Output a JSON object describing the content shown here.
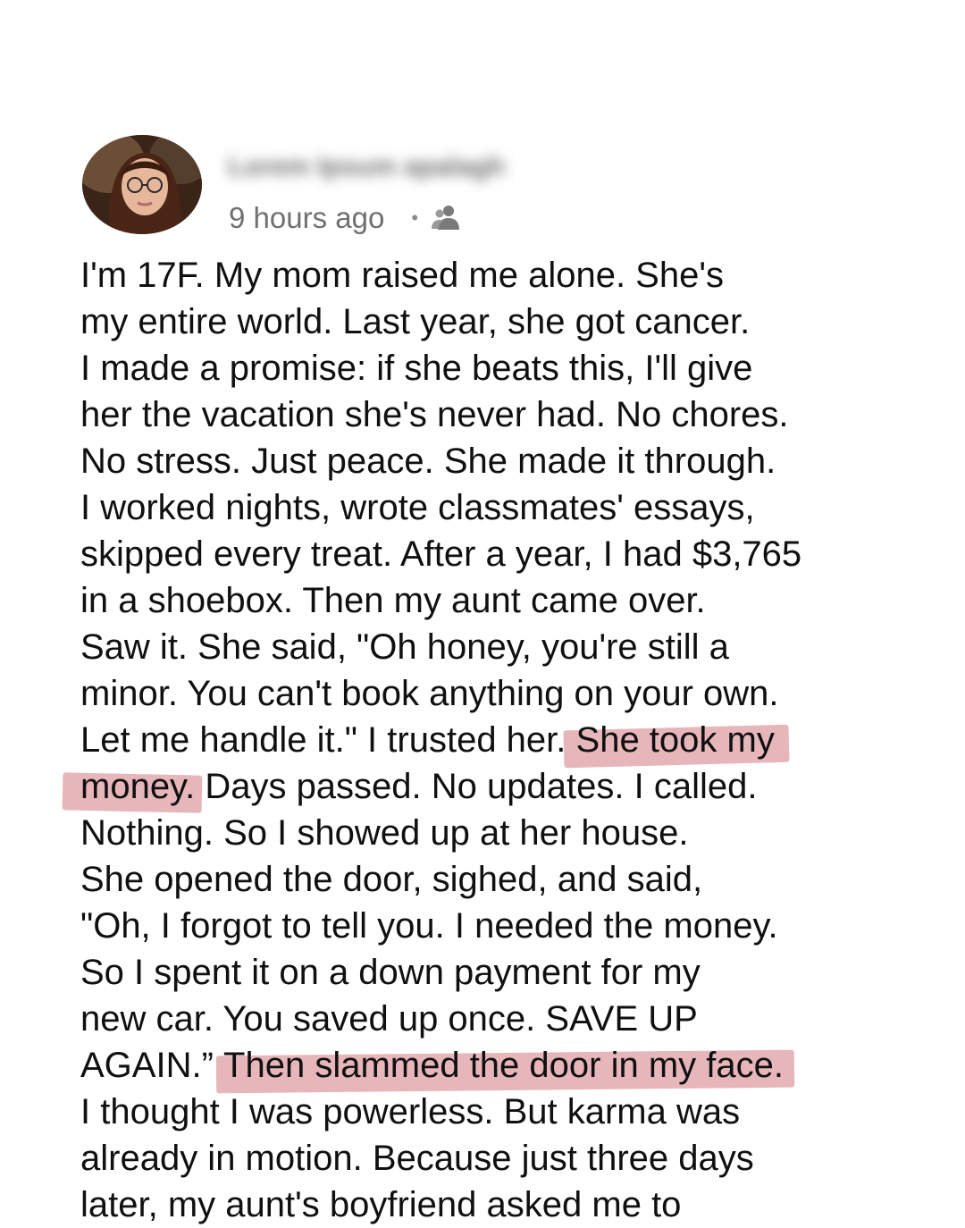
{
  "post": {
    "author_name": "Lorem Ipsum apalagh",
    "timestamp": "9 hours ago",
    "separator": "•",
    "audience_icon": "friends-icon",
    "highlight_color": "#e3a9ae",
    "lines": [
      [
        {
          "text": "I'm 17F. My mom raised me alone. She's"
        }
      ],
      [
        {
          "text": "my entire world. Last year, she got cancer."
        }
      ],
      [
        {
          "text": "I made a promise: if she beats this, I'll give"
        }
      ],
      [
        {
          "text": "her the vacation she's never had. No chores."
        }
      ],
      [
        {
          "text": "No stress. Just peace. She made it through."
        }
      ],
      [
        {
          "text": "I worked nights, wrote classmates' essays,"
        }
      ],
      [
        {
          "text": "skipped every treat. After a year, I had $3,765"
        }
      ],
      [
        {
          "text": "in a shoebox. Then my aunt came over."
        }
      ],
      [
        {
          "text": "Saw it. She said, \"Oh honey, you're still a"
        }
      ],
      [
        {
          "text": "minor. You can't book anything on your own."
        }
      ],
      [
        {
          "text": "Let me handle it.\" I trusted her. "
        },
        {
          "text": "She took my",
          "highlight": true
        }
      ],
      [
        {
          "text": "money.",
          "highlight": true
        },
        {
          "text": " Days passed. No updates. I called."
        }
      ],
      [
        {
          "text": "Nothing. So I showed up at her house."
        }
      ],
      [
        {
          "text": "She opened the door, sighed, and said,"
        }
      ],
      [
        {
          "text": "\"Oh, I forgot to tell you. I needed the money."
        }
      ],
      [
        {
          "text": "So I spent it on a down payment for my"
        }
      ],
      [
        {
          "text": "new car. You saved up once. SAVE UP"
        }
      ],
      [
        {
          "text": "AGAIN.” "
        },
        {
          "text": "Then slammed the door in my face.",
          "highlight": true
        }
      ],
      [
        {
          "text": "I thought I was powerless. But karma was"
        }
      ],
      [
        {
          "text": "already in motion. Because just three days"
        }
      ],
      [
        {
          "text": "later, my aunt's boyfriend asked me to"
        }
      ]
    ]
  }
}
